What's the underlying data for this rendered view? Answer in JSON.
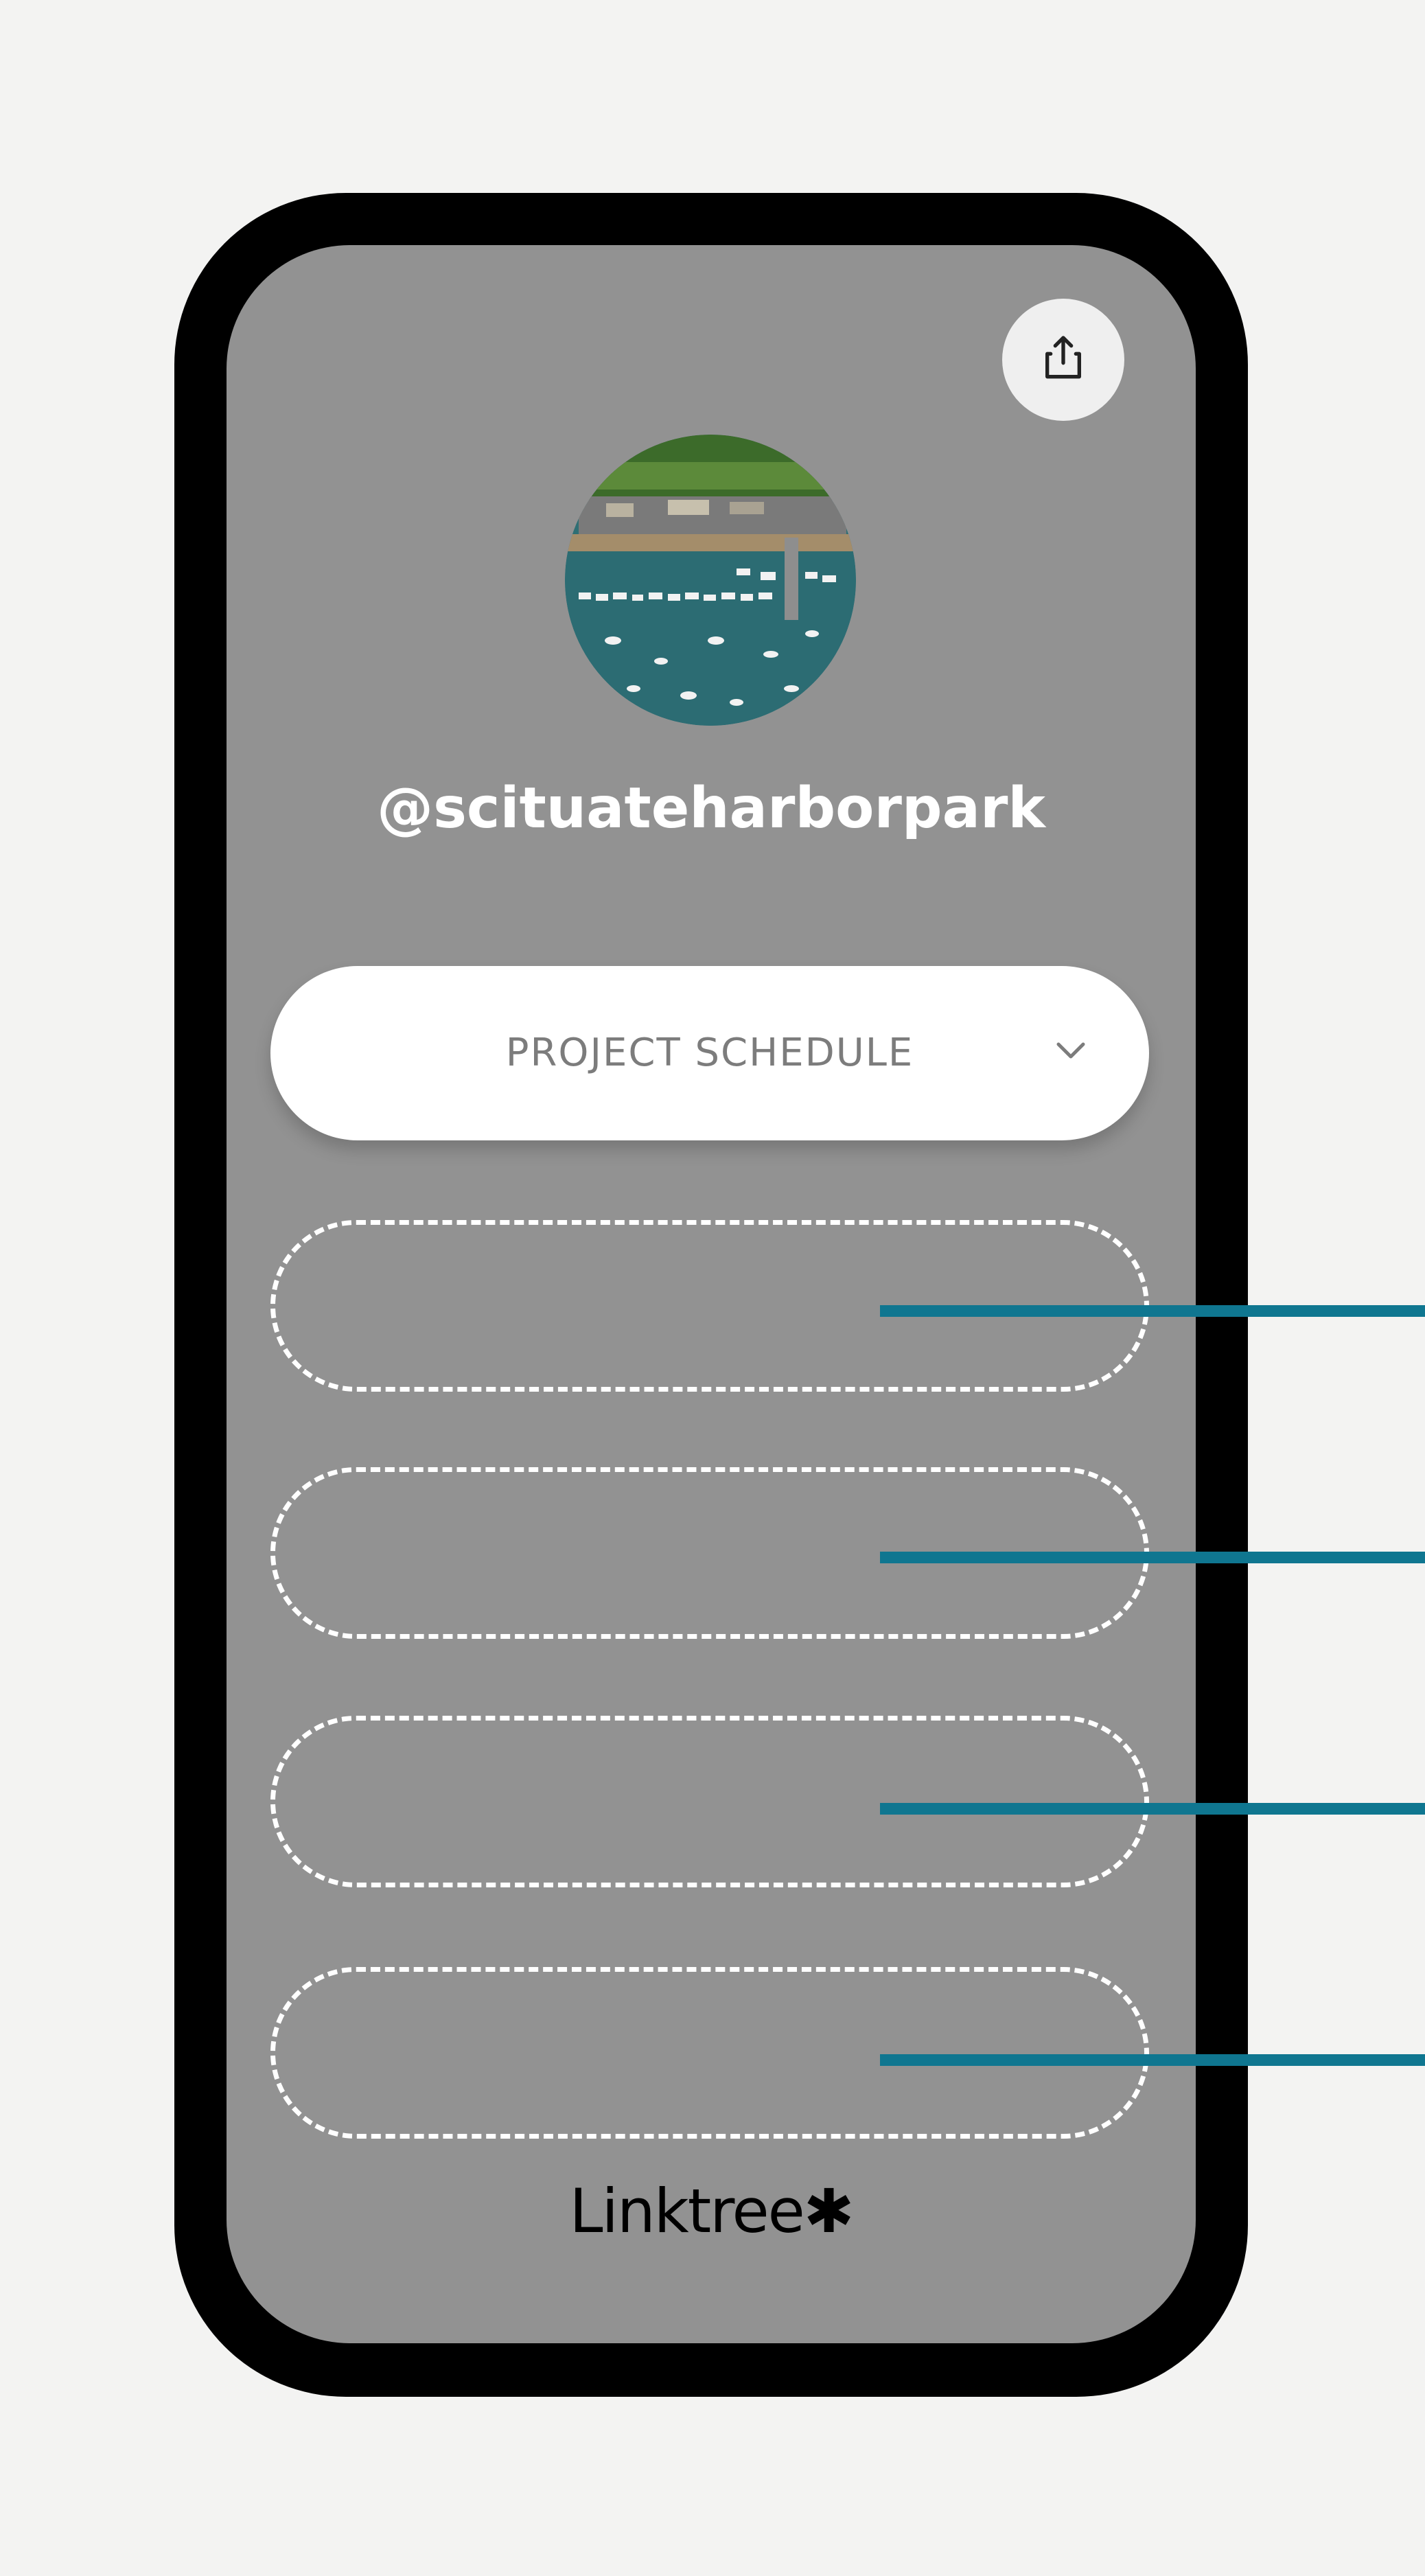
{
  "profile": {
    "username": "@scituateharborpark",
    "avatar_alt": "aerial harbor photo"
  },
  "schedule_button": {
    "label": "PROJECT SCHEDULE",
    "icon": "chevron-down-icon"
  },
  "share_button": {
    "icon": "share-icon"
  },
  "link_slots": [
    {
      "label": ""
    },
    {
      "label": ""
    },
    {
      "label": ""
    },
    {
      "label": ""
    }
  ],
  "footer": {
    "brand": "Linktree✱"
  },
  "colors": {
    "page_background": "#f3f3f2",
    "phone_frame": "#000000",
    "screen_background": "#929292",
    "callout_line": "#0f7690",
    "button_background": "#ffffff",
    "button_text": "#7c7c7c"
  }
}
